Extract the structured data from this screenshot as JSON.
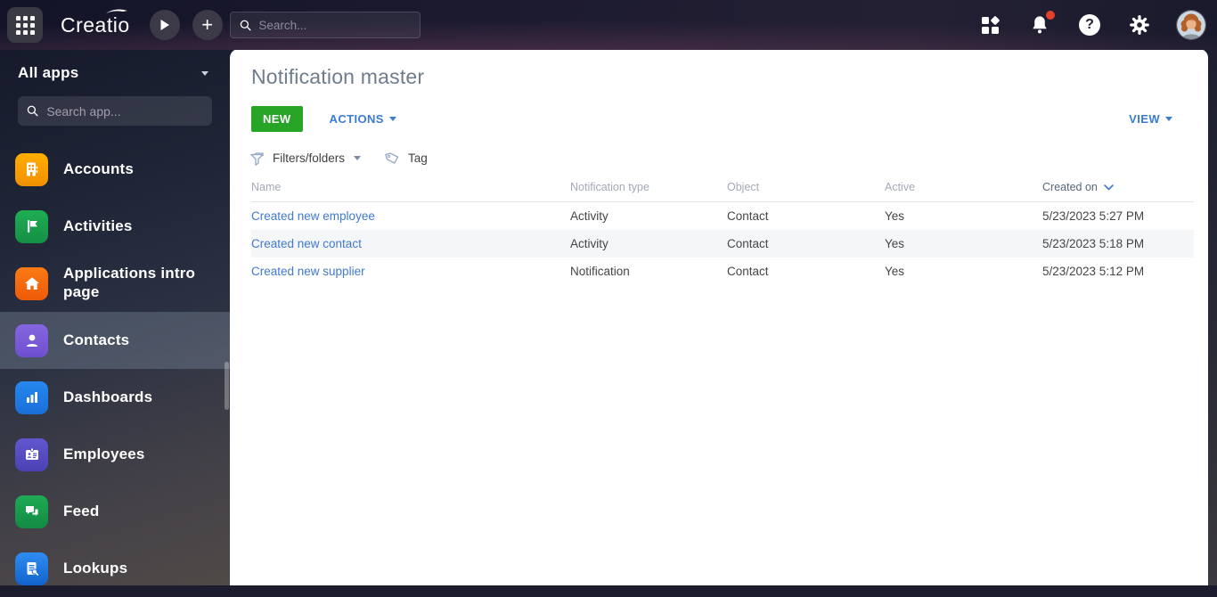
{
  "topbar": {
    "logo_text": "Creatio",
    "search_placeholder": "Search...",
    "has_notification_badge": true
  },
  "sidebar": {
    "workspace_label": "All apps",
    "search_placeholder": "Search app...",
    "items": [
      {
        "label": "Accounts",
        "icon": "building-icon",
        "color": "#f9a000",
        "active": false
      },
      {
        "label": "Activities",
        "icon": "flag-icon",
        "color": "#1aa44d",
        "active": false
      },
      {
        "label": "Applications intro page",
        "icon": "home-icon",
        "color": "#f2660e",
        "active": false
      },
      {
        "label": "Contacts",
        "icon": "person-icon",
        "color": "#7a5ad6",
        "active": true
      },
      {
        "label": "Dashboards",
        "icon": "bar-chart-icon",
        "color": "#1f7ce4",
        "active": false
      },
      {
        "label": "Employees",
        "icon": "id-card-icon",
        "color": "#574cc2",
        "active": false
      },
      {
        "label": "Feed",
        "icon": "chat-bubbles-icon",
        "color": "#189a4c",
        "active": false
      },
      {
        "label": "Lookups",
        "icon": "document-search-icon",
        "color": "#1f76dc",
        "active": false
      }
    ]
  },
  "main": {
    "title": "Notification master",
    "toolbar": {
      "new_label": "NEW",
      "actions_label": "ACTIONS",
      "view_label": "VIEW"
    },
    "filter_bar": {
      "filters_label": "Filters/folders",
      "tag_label": "Tag"
    },
    "table": {
      "columns": [
        "Name",
        "Notification type",
        "Object",
        "Active",
        "Created on"
      ],
      "sorted_column": "Created on",
      "sort_direction": "descending",
      "rows": [
        {
          "name": "Created new employee",
          "type": "Activity",
          "object": "Contact",
          "active": "Yes",
          "created_on": "5/23/2023 5:27 PM"
        },
        {
          "name": "Created new contact",
          "type": "Activity",
          "object": "Contact",
          "active": "Yes",
          "created_on": "5/23/2023 5:18 PM"
        },
        {
          "name": "Created new supplier",
          "type": "Notification",
          "object": "Contact",
          "active": "Yes",
          "created_on": "5/23/2023 5:12 PM"
        }
      ]
    }
  },
  "colors": {
    "new_button_green": "#28a426",
    "action_link_blue": "#3a7bd5",
    "row_link_blue": "#4179cf",
    "notification_badge_red": "#e2402a",
    "title_gray": "#6e7c8c",
    "highlight_row": "#f5f6f7"
  }
}
